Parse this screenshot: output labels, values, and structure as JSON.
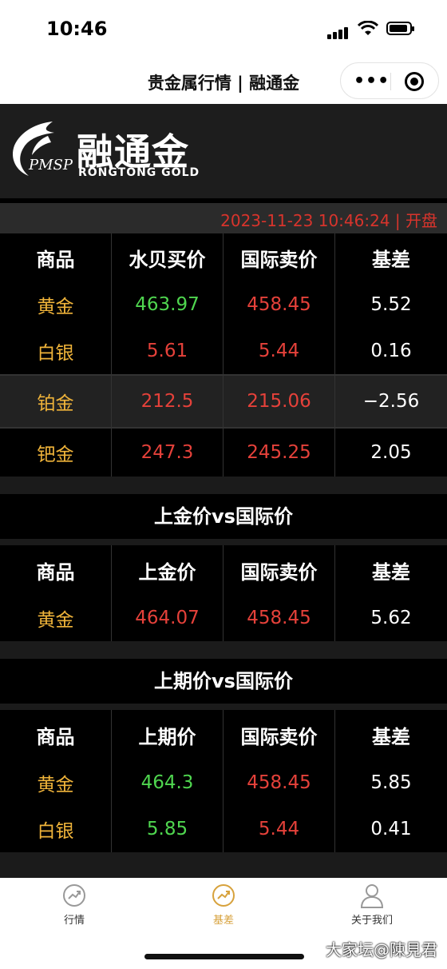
{
  "status": {
    "time": "10:46"
  },
  "nav": {
    "title": "贵金属行情 | 融通金"
  },
  "brand": {
    "pmsp": "PMSP",
    "cn": "融通金",
    "en": "RONGTONG GOLD"
  },
  "datetime": "2023-11-23 10:46:24 | 开盘",
  "table1": {
    "headers": [
      "商品",
      "水贝买价",
      "国际卖价",
      "基差"
    ],
    "rows": [
      {
        "name": "黄金",
        "buy": "463.97",
        "intl": "458.45",
        "diff": "5.52"
      },
      {
        "name": "白银",
        "buy": "5.61",
        "intl": "5.44",
        "diff": "0.16"
      },
      {
        "name": "铂金",
        "buy": "212.5",
        "intl": "215.06",
        "diff": "−2.56"
      },
      {
        "name": "钯金",
        "buy": "247.3",
        "intl": "245.25",
        "diff": "2.05"
      }
    ]
  },
  "table2": {
    "title": "上金价vs国际价",
    "headers": [
      "商品",
      "上金价",
      "国际卖价",
      "基差"
    ],
    "rows": [
      {
        "name": "黄金",
        "buy": "464.07",
        "intl": "458.45",
        "diff": "5.62"
      }
    ]
  },
  "table3": {
    "title": "上期价vs国际价",
    "headers": [
      "商品",
      "上期价",
      "国际卖价",
      "基差"
    ],
    "rows": [
      {
        "name": "黄金",
        "buy": "464.3",
        "intl": "458.45",
        "diff": "5.85"
      },
      {
        "name": "白银",
        "buy": "5.85",
        "intl": "5.44",
        "diff": "0.41"
      }
    ]
  },
  "tabs": [
    {
      "label": "行情",
      "icon": "trend-icon"
    },
    {
      "label": "基差",
      "icon": "trend-icon"
    },
    {
      "label": "关于我们",
      "icon": "user-icon"
    }
  ],
  "watermark": "大家坛@陳見君",
  "colors": {
    "up": "#4fd64f",
    "down": "#e5413a",
    "name": "#f0b43a",
    "accent": "#d7a23c"
  }
}
